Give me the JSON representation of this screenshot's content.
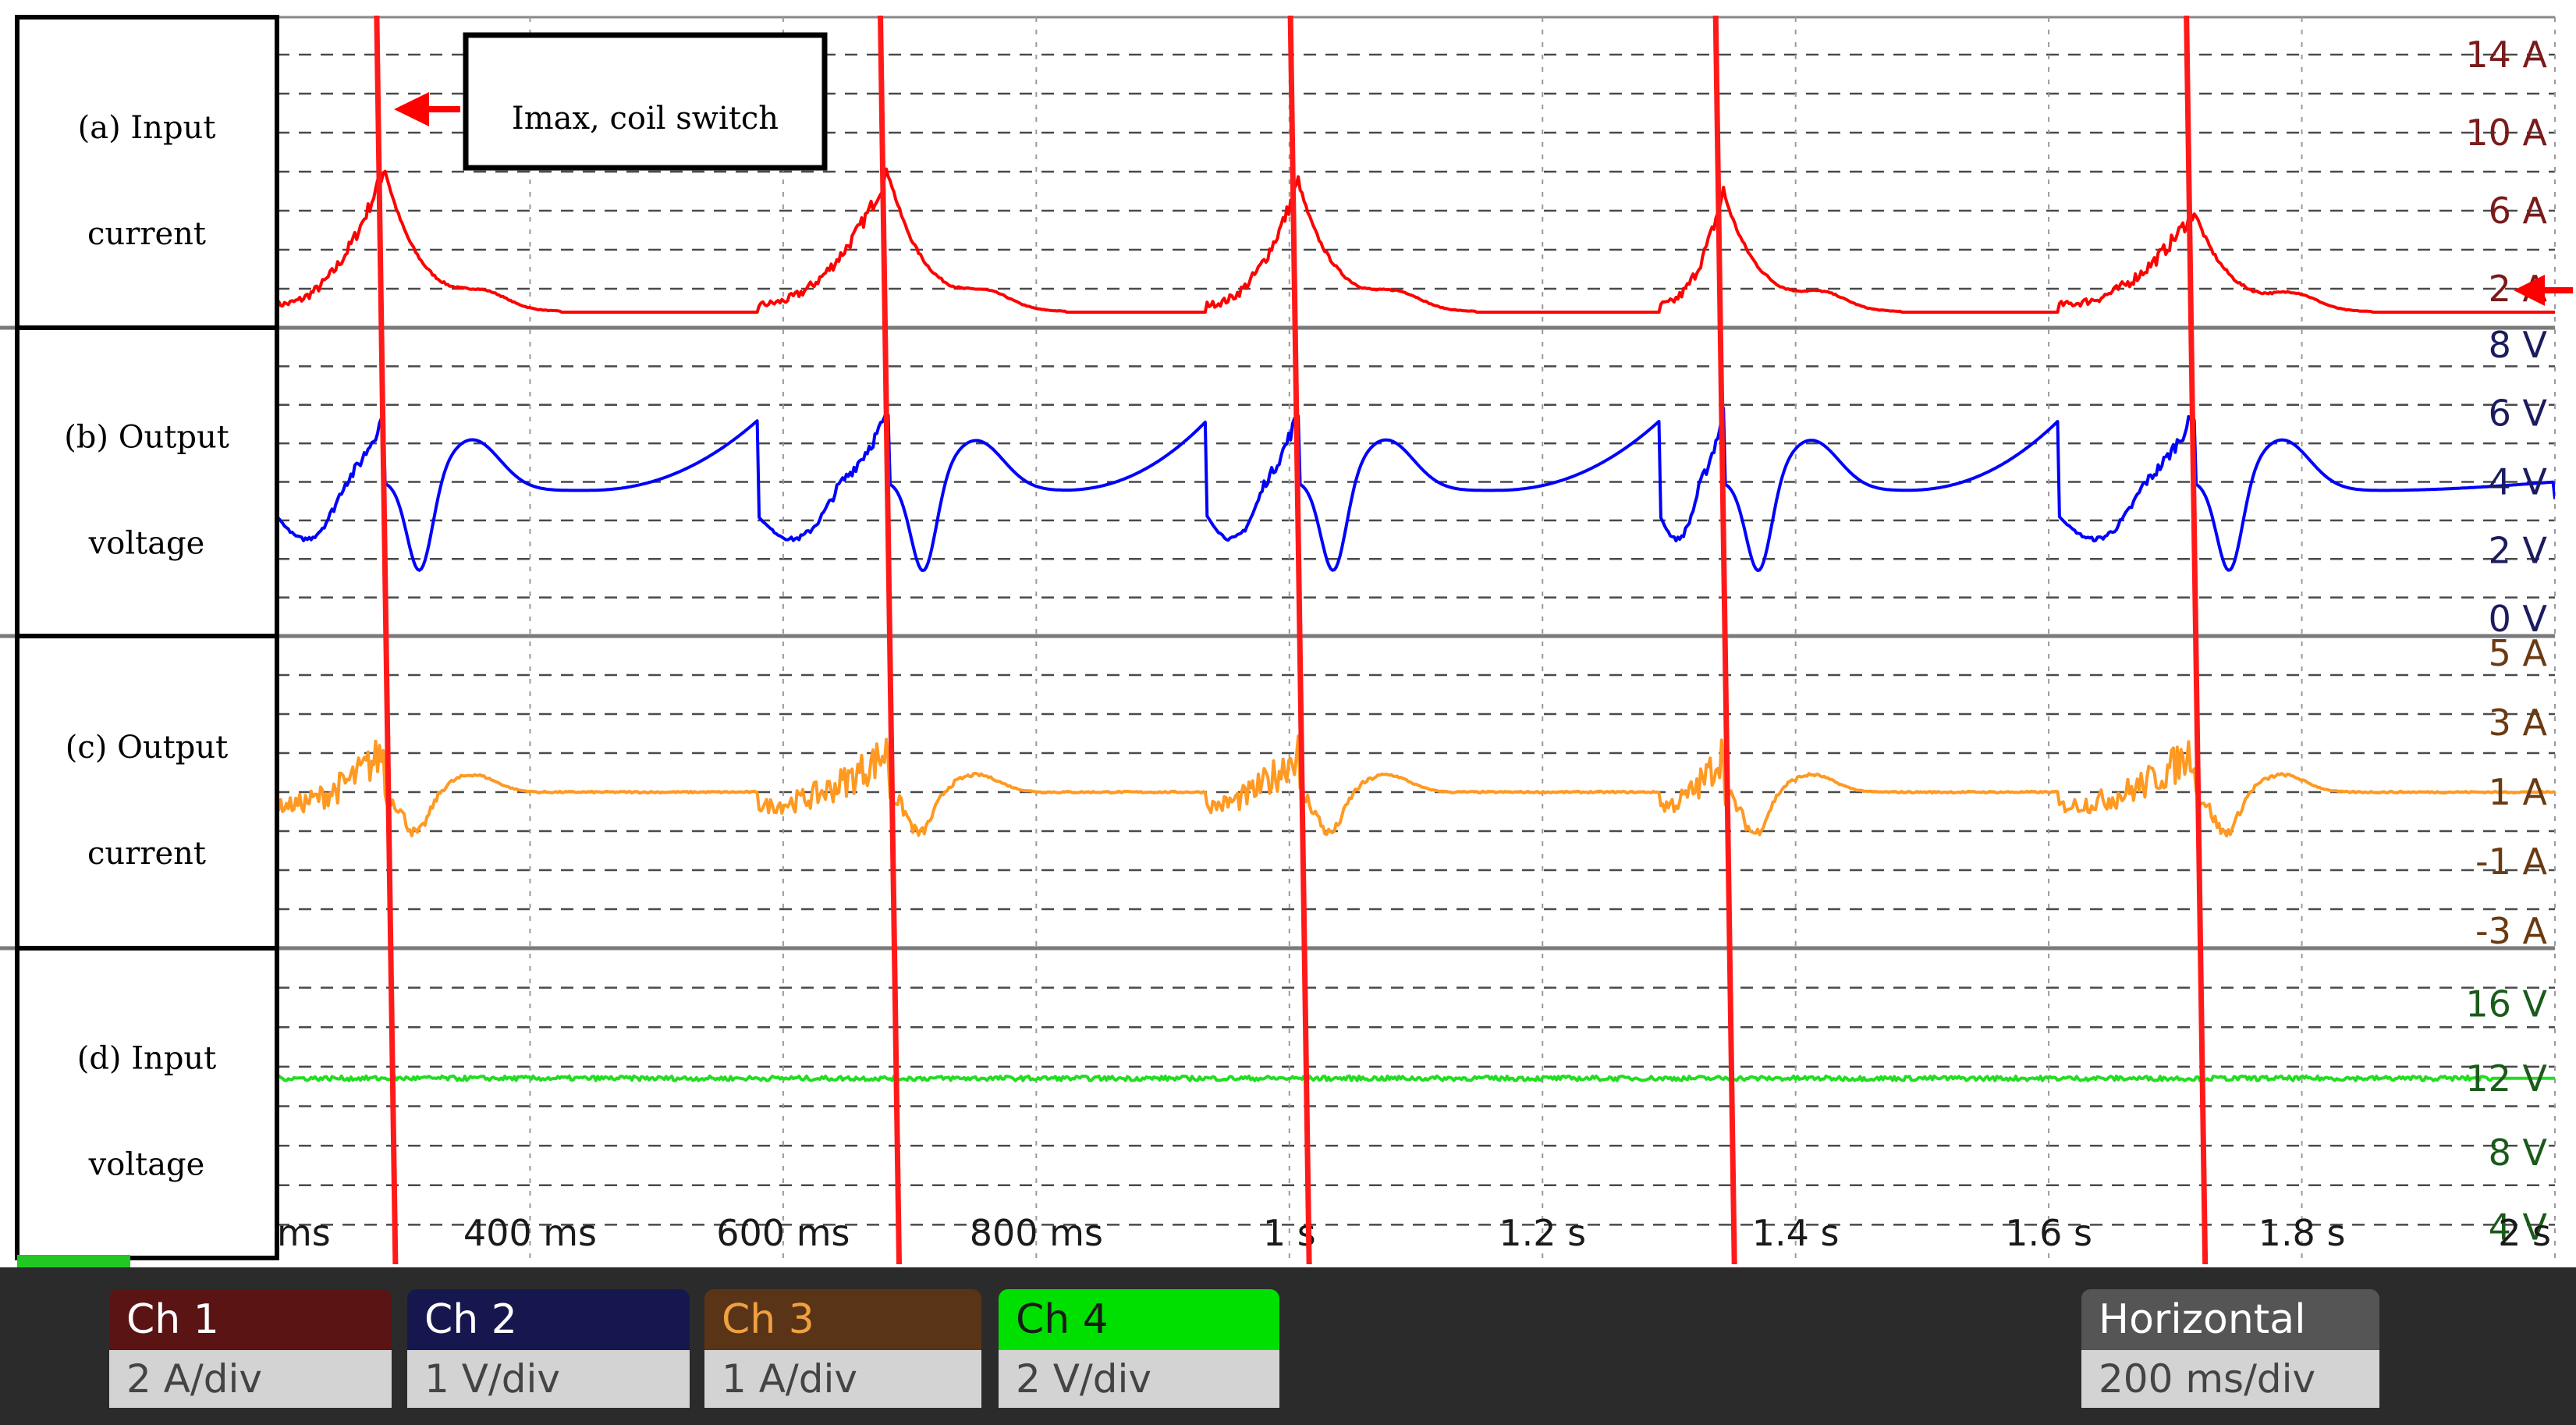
{
  "panels": [
    {
      "label_line1": "(a) Input",
      "label_line2": "current"
    },
    {
      "label_line1": "(b) Output",
      "label_line2": "voltage"
    },
    {
      "label_line1": "(c) Output",
      "label_line2": "current"
    },
    {
      "label_line1": "(d) Input",
      "label_line2": "voltage"
    }
  ],
  "annotation": "Imax, coil switch",
  "channels": [
    {
      "name": "Ch 1",
      "scale": "2 A/div",
      "color": "#5a1414",
      "text_color": "#ffffff"
    },
    {
      "name": "Ch 2",
      "scale": "1 V/div",
      "color": "#17174f",
      "text_color": "#ffffff"
    },
    {
      "name": "Ch 3",
      "scale": "1 A/div",
      "color": "#5a3417",
      "text_color": "#f0a040"
    },
    {
      "name": "Ch 4",
      "scale": "2 V/div",
      "color": "#00e000",
      "text_color": "#1a1a1a"
    }
  ],
  "horizontal": {
    "name": "Horizontal",
    "scale": "200 ms/div"
  },
  "chart_data": {
    "type": "line",
    "x_ticks": [
      "ms",
      "400 ms",
      "600 ms",
      "800 ms",
      "1 s",
      "1.2 s",
      "1.4 s",
      "1.6 s",
      "1.8 s",
      "2 s"
    ],
    "x_tick_values": [
      200,
      400,
      600,
      800,
      1000,
      1200,
      1400,
      1600,
      1800,
      2000
    ],
    "xlim": [
      200,
      2000
    ],
    "coil_switch_times_ms": [
      285,
      683,
      1007,
      1343,
      1715
    ],
    "coil_switch_peak_input_current_A": [
      8.2,
      8.0,
      7.5,
      7.0,
      6.0
    ],
    "series": [
      {
        "name": "Ch 1",
        "color": "#ff0000",
        "ylim": [
          0,
          16
        ],
        "y_ticks": [
          "14 A",
          "10 A",
          "6 A",
          "2 A"
        ],
        "y_tick_values": [
          14,
          10,
          6,
          2
        ],
        "tick_color": "#7a1a1a"
      },
      {
        "name": "Ch 2",
        "color": "#0000ff",
        "ylim": [
          -0.5,
          8.5
        ],
        "y_ticks": [
          "8 V",
          "6 V",
          "4 V",
          "2 V",
          "0 V"
        ],
        "y_tick_values": [
          8,
          6,
          4,
          2,
          0
        ],
        "tick_color": "#1b1b5e"
      },
      {
        "name": "Ch 3",
        "color": "#ff9922",
        "ylim": [
          -3.5,
          5.5
        ],
        "y_ticks": [
          "5 A",
          "3 A",
          "1 A",
          "-1 A",
          "-3 A"
        ],
        "y_tick_values": [
          5,
          3,
          1,
          -1,
          -3
        ],
        "tick_color": "#6a3a12"
      },
      {
        "name": "Ch 4",
        "color": "#22dd22",
        "ylim": [
          2,
          19
        ],
        "y_ticks": [
          "16 V",
          "12 V",
          "8 V",
          "4 V"
        ],
        "y_tick_values": [
          16,
          12,
          8,
          4
        ],
        "tick_color": "#1a5a1a",
        "level_V": 12
      }
    ]
  }
}
